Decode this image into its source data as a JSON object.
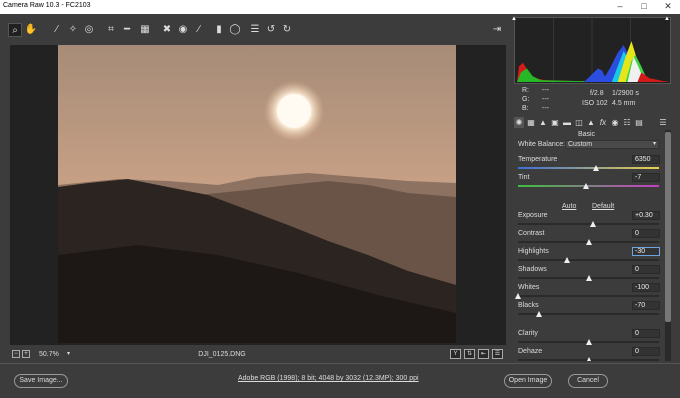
{
  "window": {
    "title": "Camera Raw 10.3 -  FC2103",
    "minimize_icon": "minimize-icon",
    "maximize_icon": "maximize-icon",
    "close_icon": "close-icon"
  },
  "toolbar": {
    "tools": [
      {
        "name": "zoom-tool",
        "icon": "magnifier-icon",
        "glyph": "⌕",
        "selected": true
      },
      {
        "name": "hand-tool",
        "icon": "hand-icon",
        "glyph": "✋"
      },
      {
        "name": "white-balance-tool",
        "icon": "eyedropper-icon",
        "glyph": "⁄"
      },
      {
        "name": "color-sampler-tool",
        "icon": "sampler-icon",
        "glyph": "✧"
      },
      {
        "name": "targeted-adjustment-tool",
        "icon": "target-icon",
        "glyph": "◎"
      },
      {
        "name": "crop-tool",
        "icon": "crop-icon",
        "glyph": "⌗"
      },
      {
        "name": "straighten-tool",
        "icon": "straighten-icon",
        "glyph": "━"
      },
      {
        "name": "transform-tool",
        "icon": "transform-icon",
        "glyph": "▦"
      },
      {
        "name": "spot-removal-tool",
        "icon": "spot-removal-icon",
        "glyph": "✖"
      },
      {
        "name": "red-eye-tool",
        "icon": "eye-icon",
        "glyph": "◉"
      },
      {
        "name": "adjustment-brush-tool",
        "icon": "brush-icon",
        "glyph": "∕"
      },
      {
        "name": "graduated-filter-tool",
        "icon": "graduated-filter-icon",
        "glyph": "▮"
      },
      {
        "name": "radial-filter-tool",
        "icon": "radial-filter-icon",
        "glyph": "◯"
      },
      {
        "name": "preferences",
        "icon": "list-icon",
        "glyph": "☰"
      },
      {
        "name": "rotate-left",
        "icon": "rotate-left-icon",
        "glyph": "↺"
      },
      {
        "name": "rotate-right",
        "icon": "rotate-right-icon",
        "glyph": "↻"
      }
    ],
    "open_dialog_icon": "export-icon"
  },
  "status": {
    "zoom": "50.7%",
    "filename": "DJI_0125.DNG"
  },
  "bottom": {
    "save_label": "Save Image...",
    "workflow": "Adobe RGB (1998); 8 bit; 4048 by 3032 (12.3MP); 300 ppi",
    "open_label": "Open Image",
    "cancel_label": "Cancel"
  },
  "readout": {
    "r": "R:",
    "g": "G:",
    "b": "B:",
    "dash": "---",
    "aperture": "f/2.8",
    "shutter": "1/2900 s",
    "iso": "ISO 102",
    "focal": "4.5 mm"
  },
  "panel": {
    "title": "Basic",
    "white_balance_label": "White Balance:",
    "white_balance_value": "Custom",
    "auto": "Auto",
    "default": "Default",
    "sliders": [
      {
        "id": "temperature",
        "label": "Temperature",
        "value": "6350",
        "norm": 0.55
      },
      {
        "id": "tint",
        "label": "Tint",
        "value": "-7",
        "norm": 0.48
      },
      {
        "id": "exposure",
        "label": "Exposure",
        "value": "+0.30",
        "norm": 0.53
      },
      {
        "id": "contrast",
        "label": "Contrast",
        "value": "0",
        "norm": 0.5
      },
      {
        "id": "highlights",
        "label": "Highlights",
        "value": "-30",
        "norm": 0.35,
        "active": true
      },
      {
        "id": "shadows",
        "label": "Shadows",
        "value": "0",
        "norm": 0.5
      },
      {
        "id": "whites",
        "label": "Whites",
        "value": "-100",
        "norm": 0.0
      },
      {
        "id": "blacks",
        "label": "Blacks",
        "value": "-70",
        "norm": 0.15
      },
      {
        "id": "clarity",
        "label": "Clarity",
        "value": "0",
        "norm": 0.5
      },
      {
        "id": "dehaze",
        "label": "Dehaze",
        "value": "0",
        "norm": 0.5
      }
    ]
  },
  "colors": {
    "panel_bg": "#3c3c3c",
    "dark_bg": "#222222",
    "temp_start": "#3a6fd8",
    "temp_end": "#e8d24a",
    "tint_start": "#3fbf3f",
    "tint_end": "#c43fc4"
  }
}
